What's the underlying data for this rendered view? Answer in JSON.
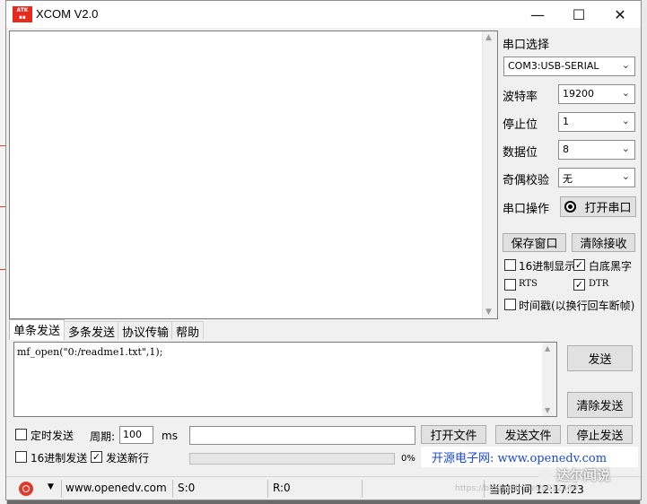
{
  "window": {
    "title": "XCOM V2.0",
    "app_icon_text": "ATK",
    "minimize_glyph": "—",
    "maximize_glyph": "☐",
    "close_glyph": "✕"
  },
  "serial": {
    "port_label": "串口选择",
    "port_value": "COM3:USB-SERIAL",
    "baud_label": "波特率",
    "baud_value": "19200",
    "stop_label": "停止位",
    "stop_value": "1",
    "data_label": "数据位",
    "data_value": "8",
    "parity_label": "奇偶校验",
    "parity_value": "无",
    "op_label": "串口操作",
    "open_button": "打开串口",
    "save_window": "保存窗口",
    "clear_receive": "清除接收",
    "hex_display": {
      "label": "16进制显示",
      "checked": false
    },
    "white_black": {
      "label": "白底黑字",
      "checked": true
    },
    "rts": {
      "label": "RTS",
      "checked": false
    },
    "dtr": {
      "label": "DTR",
      "checked": true
    },
    "timestamp": {
      "label": "时间戳(以换行回车断帧)",
      "checked": false
    }
  },
  "tabs": [
    "单条发送",
    "多条发送",
    "协议传输",
    "帮助"
  ],
  "send": {
    "text": "mf_open(\"0:/readme1.txt\",1);",
    "send_button": "发送",
    "clear_send_button": "清除发送",
    "timed_send": {
      "label": "定时发送",
      "checked": false
    },
    "period_label": "周期:",
    "period_value": "100",
    "period_unit": "ms",
    "hex_send": {
      "label": "16进制发送",
      "checked": false
    },
    "newline": {
      "label": "发送新行",
      "checked": true
    },
    "progress_percent": 0,
    "progress_text": "0%",
    "open_file_button": "打开文件",
    "send_file_button": "发送文件",
    "stop_send_button": "停止发送",
    "website_banner": "开源电子网: www.openedv.com"
  },
  "status": {
    "url": "www.openedv.com",
    "s_count": "S:0",
    "r_count": "R:0",
    "time_label": "当前时间 12:17:23"
  },
  "overlay": {
    "wechat_name": "达尔闻说",
    "url_watermark": "https://blog.csdn.net/u012468"
  },
  "colors": {
    "accent_red": "#e62b1e",
    "link_blue": "#1a46d6",
    "progress_green": "#06b025"
  }
}
